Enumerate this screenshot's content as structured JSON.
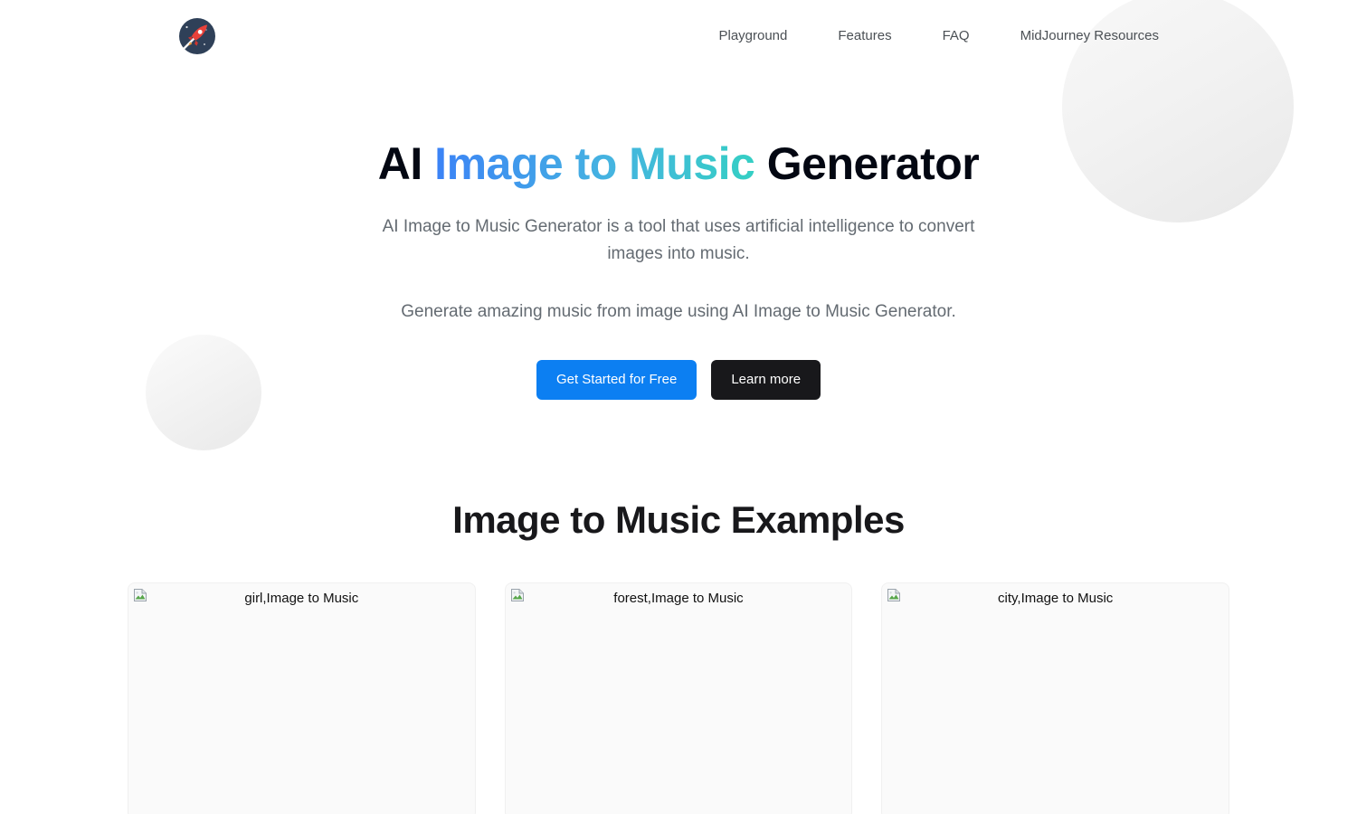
{
  "header": {
    "logo": {
      "icon": "rocket-logo-icon",
      "circle_color": "#2f4058",
      "rocket_color": "#e8413a",
      "alt": "Rocket logo"
    },
    "nav": [
      {
        "label": "Playground"
      },
      {
        "label": "Features"
      },
      {
        "label": "FAQ"
      },
      {
        "label": "MidJourney Resources"
      }
    ]
  },
  "hero": {
    "title_part1": "AI ",
    "title_highlight": "Image to Music",
    "title_part2": " Generator",
    "subtitle": "AI Image to Music Generator is a tool that uses artificial intelligence to convert images into music.",
    "subtitle_2": "Generate amazing music from image using AI Image to Music Generator.",
    "primary_cta": "Get Started for Free",
    "secondary_cta": "Learn more",
    "colors": {
      "gradient_start": "#3b82f6",
      "gradient_end": "#35cfc4",
      "primary_button": "#0c7ff2",
      "secondary_button": "#18181b"
    }
  },
  "examples": {
    "title": "Image to Music Examples",
    "cards": [
      {
        "alt": "girl,Image to Music",
        "icon": "broken-image-icon"
      },
      {
        "alt": "forest,Image to Music",
        "icon": "broken-image-icon"
      },
      {
        "alt": "city,Image to Music",
        "icon": "broken-image-icon"
      }
    ]
  },
  "decor": {
    "circle_top_right": "#f2f2f2",
    "circle_left": "#f3f3f3"
  }
}
